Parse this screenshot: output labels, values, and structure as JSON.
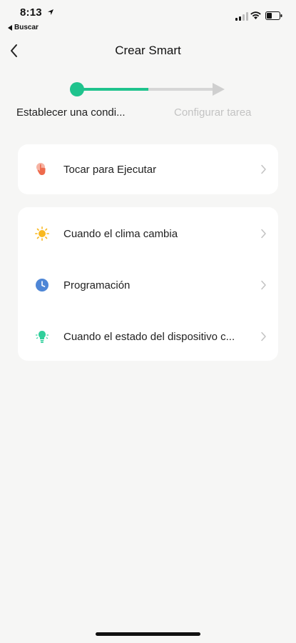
{
  "status_bar": {
    "time": "8:13",
    "back_app": "Buscar"
  },
  "nav": {
    "title": "Crear Smart"
  },
  "stepper": {
    "step1_label": "Establecer una condi...",
    "step2_label": "Configurar tarea",
    "active_color": "#1fc38d"
  },
  "conditions": {
    "group1": [
      {
        "label": "Tocar para Ejecutar",
        "icon": "tap-hand-icon"
      }
    ],
    "group2": [
      {
        "label": "Cuando el clima cambia",
        "icon": "sun-icon"
      },
      {
        "label": "Programación",
        "icon": "clock-icon"
      },
      {
        "label": "Cuando el estado del dispositivo c...",
        "icon": "device-bulb-icon"
      }
    ]
  }
}
